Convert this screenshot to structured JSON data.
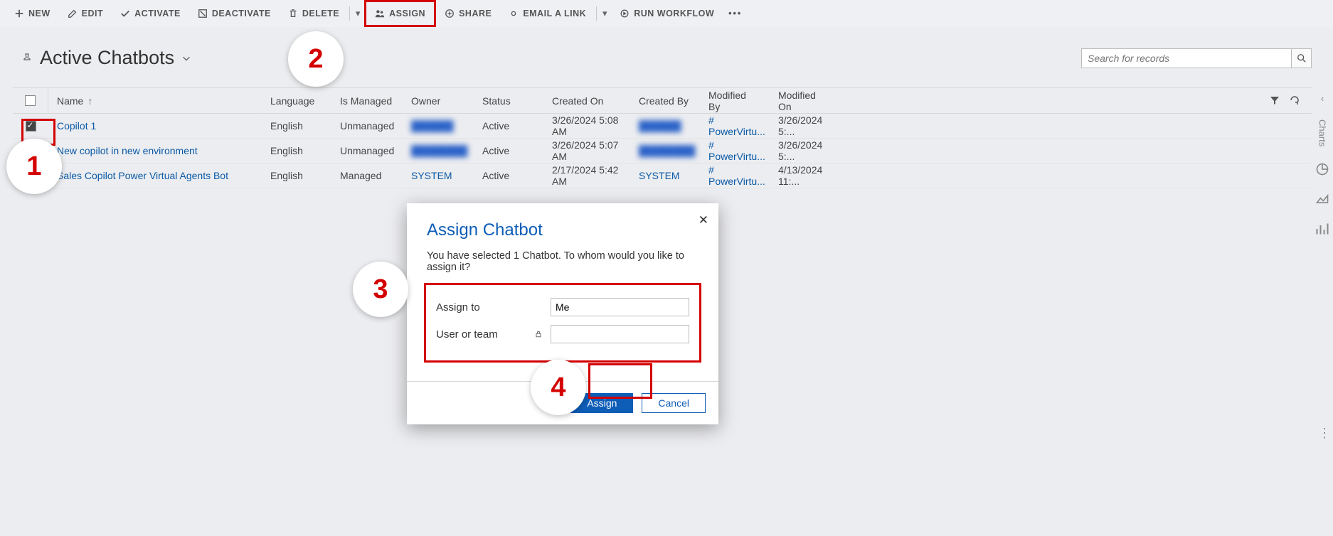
{
  "commandbar": {
    "new": "NEW",
    "edit": "EDIT",
    "activate": "ACTIVATE",
    "deactivate": "DEACTIVATE",
    "delete": "DELETE",
    "assign": "ASSIGN",
    "share": "SHARE",
    "emailLink": "EMAIL A LINK",
    "runWorkflow": "RUN WORKFLOW"
  },
  "view": {
    "title": "Active Chatbots",
    "search_placeholder": "Search for records"
  },
  "grid": {
    "headers": {
      "name": "Name",
      "language": "Language",
      "isManaged": "Is Managed",
      "owner": "Owner",
      "status": "Status",
      "createdOn": "Created On",
      "createdBy": "Created By",
      "modifiedBy": "Modified By",
      "modifiedOn": "Modified On"
    },
    "rows": [
      {
        "checked": true,
        "name": "Copilot 1",
        "language": "English",
        "isManaged": "Unmanaged",
        "owner": "",
        "ownerBlurred": true,
        "status": "Active",
        "createdOn": "3/26/2024 5:08 AM",
        "createdBy": "",
        "createdByBlurred": true,
        "modifiedBy": "# PowerVirtu...",
        "modifiedOn": "3/26/2024 5:..."
      },
      {
        "checked": false,
        "name": "New copilot in new environment",
        "language": "English",
        "isManaged": "Unmanaged",
        "owner": "",
        "ownerBlurred": true,
        "status": "Active",
        "createdOn": "3/26/2024 5:07 AM",
        "createdBy": "",
        "createdByBlurred": true,
        "modifiedBy": "# PowerVirtu...",
        "modifiedOn": "3/26/2024 5:..."
      },
      {
        "checked": false,
        "name": "Sales Copilot Power Virtual Agents Bot",
        "language": "English",
        "isManaged": "Managed",
        "owner": "SYSTEM",
        "status": "Active",
        "createdOn": "2/17/2024 5:42 AM",
        "createdBy": "SYSTEM",
        "modifiedBy": "# PowerVirtu...",
        "modifiedOn": "4/13/2024 11:..."
      }
    ]
  },
  "dialog": {
    "title": "Assign Chatbot",
    "subtitle": "You have selected 1 Chatbot. To whom would you like to assign it?",
    "assignTo_label": "Assign to",
    "assignTo_value": "Me",
    "userTeam_label": "User or team",
    "userTeam_value": "",
    "assign_btn": "Assign",
    "cancel_btn": "Cancel"
  },
  "rail": {
    "label": "Charts"
  },
  "callouts": {
    "c1": "1",
    "c2": "2",
    "c3": "3",
    "c4": "4"
  }
}
